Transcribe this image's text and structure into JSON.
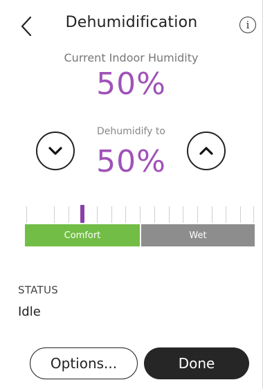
{
  "header": {
    "title": "Dehumidification",
    "info_label": "i"
  },
  "current": {
    "label": "Current Indoor Humidity",
    "value": "50%"
  },
  "setpoint": {
    "label": "Dehumidify to",
    "value": "50%"
  },
  "scale": {
    "marker_level": 0.25,
    "comfort_label": "Comfort",
    "wet_label": "Wet",
    "comfort_color": "#72bd45",
    "wet_color": "#8d8d8d",
    "marker_color": "#8a3fa8"
  },
  "status": {
    "heading": "STATUS",
    "value": "Idle"
  },
  "buttons": {
    "options_label": "Options...",
    "done_label": "Done"
  },
  "colors": {
    "accent": "#a052b8"
  },
  "icons": {
    "back": "chevron-left-icon",
    "down": "chevron-down-icon",
    "up": "chevron-up-icon",
    "info": "info-icon"
  }
}
